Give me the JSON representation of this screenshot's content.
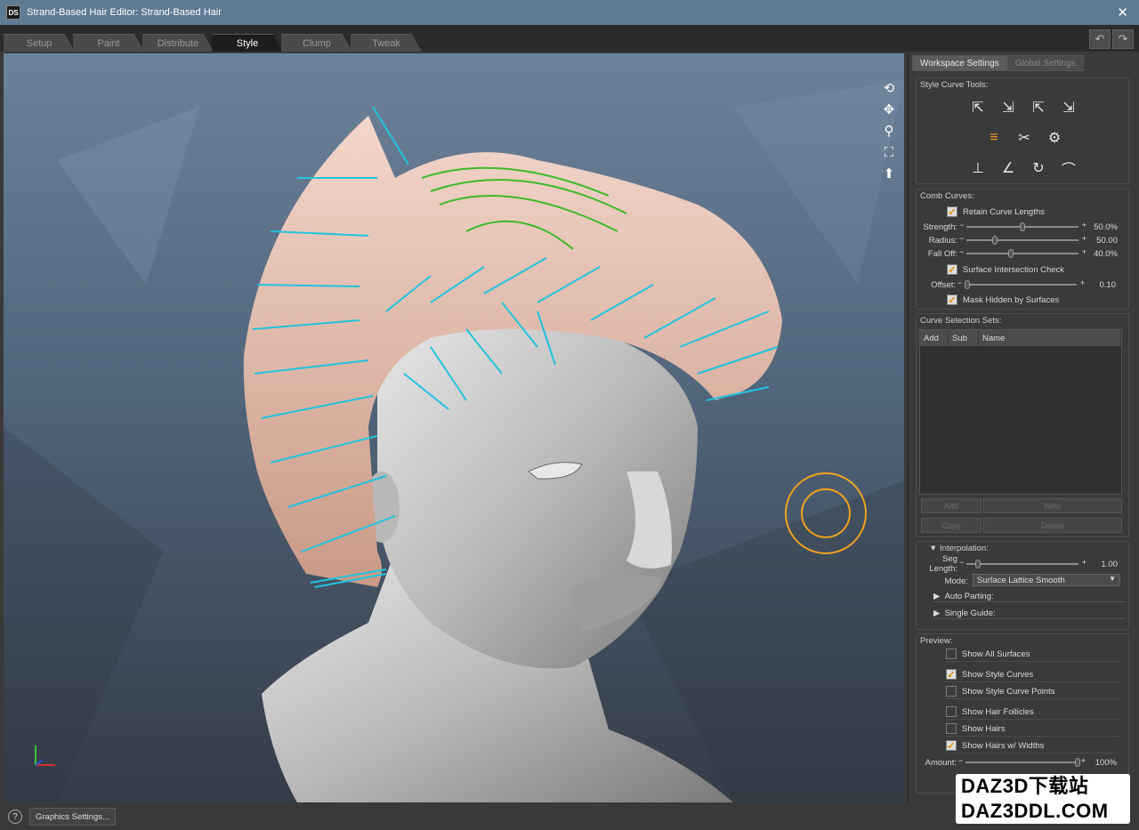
{
  "window": {
    "logo": "DS",
    "title": "Strand-Based Hair Editor: Strand-Based Hair",
    "close_icon": "✕"
  },
  "tabs": [
    "Setup",
    "Paint",
    "Distribute",
    "Style",
    "Clump",
    "Tweak"
  ],
  "active_tab": "Style",
  "toolbar": {
    "undo_icon": "↶",
    "redo_icon": "↷"
  },
  "viewport": {
    "nav_icons": [
      "orbit-icon",
      "pan-icon",
      "zoom-icon",
      "frame-icon",
      "reset-view-icon"
    ],
    "hair_color": "#e9c5b8",
    "guide_color": "#22c3dd",
    "selected_guide_color": "#3cba2a",
    "brush_color": "#f2a21e"
  },
  "panel": {
    "tabs": [
      "Workspace Settings",
      "Global Settings"
    ],
    "style_curve_tools": {
      "label": "Style Curve Tools:",
      "icons": [
        "select-curve-icon",
        "select-add-icon",
        "select-remove-icon",
        "select-toggle-icon",
        "comb-icon",
        "cut-icon",
        "settings-cog-icon",
        "point-tool-icon",
        "line-tool-icon",
        "curl-tool-icon",
        "bend-tool-icon"
      ]
    },
    "comb_curves": {
      "label": "Comb Curves:",
      "retain_curve_lengths": "Retain Curve Lengths",
      "strength_label": "Strength:",
      "strength_value": "50.0%",
      "strength_fraction": 0.5,
      "radius_label": "Radius:",
      "radius_value": "50.00",
      "radius_fraction": 0.25,
      "falloff_label": "Fall Off:",
      "falloff_value": "40.0%",
      "falloff_fraction": 0.4,
      "surface_check": "Surface Intersection Check",
      "offset_label": "Offset:",
      "offset_value": "0.10",
      "offset_fraction": 0.02,
      "mask_hidden": "Mask Hidden by Surfaces"
    },
    "selection_sets": {
      "label": "Curve Selection Sets:",
      "col_add": "Add",
      "col_sub": "Sub",
      "col_name": "Name",
      "btn_add": "Add",
      "btn_new": "New",
      "btn_copy": "Copy",
      "btn_delete": "Delete"
    },
    "interpolation": {
      "label": "Interpolation:",
      "seg_length_label": "Seg Length:",
      "seg_length_value": "1.00",
      "seg_length_fraction": 0.1,
      "mode_label": "Mode:",
      "mode_value": "Surface Lattice Smooth",
      "auto_parting": "Auto Parting:",
      "single_guide": "Single Guide:"
    },
    "preview": {
      "label": "Preview:",
      "show_all_surfaces": "Show All Surfaces",
      "show_style_curves": "Show Style Curves",
      "show_style_curve_points": "Show Style Curve Points",
      "show_hair_follicles": "Show Hair Follicles",
      "show_hairs": "Show Hairs",
      "show_hairs_widths": "Show Hairs w/ Widths",
      "amount_label": "Amount:",
      "amount_value": "100%",
      "amount_fraction": 1.0
    }
  },
  "statusbar": {
    "help_icon": "?",
    "graphics_settings": "Graphics Settings..."
  },
  "watermark": {
    "line1": "DAZ3D下载站",
    "line2": "DAZ3DDL.COM"
  }
}
